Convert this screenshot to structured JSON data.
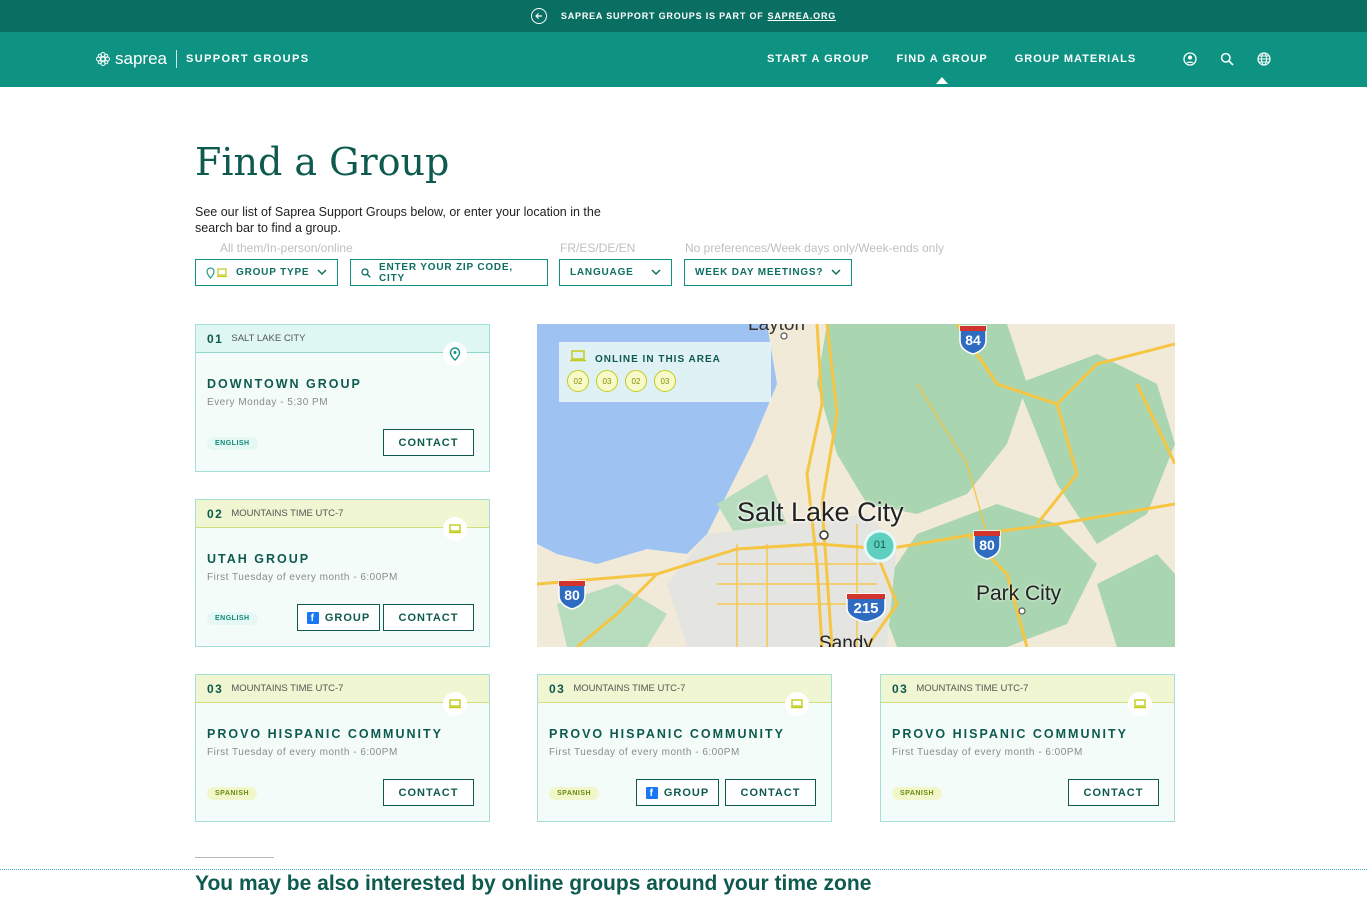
{
  "topbar": {
    "text": "SAPREA SUPPORT GROUPS IS PART OF",
    "link": "SAPREA.ORG"
  },
  "header": {
    "brand": "saprea",
    "sub": "SUPPORT GROUPS",
    "nav": [
      "START A GROUP",
      "FIND A GROUP",
      "GROUP MATERIALS"
    ],
    "active_nav": "FIND A GROUP",
    "icons": [
      "user-icon",
      "search-icon",
      "globe-icon"
    ]
  },
  "page": {
    "title": "Find a Group",
    "intro": "See our list of Saprea Support Groups below, or enter your location in the search bar to find a group."
  },
  "filters": {
    "hints": [
      "All them/In-person/online",
      "FR/ES/DE/EN",
      "No preferences/Week days only/Week-ends only"
    ],
    "group_type": "GROUP TYPE",
    "zip_placeholder": "ENTER YOUR ZIP CODE, CITY",
    "language": "LANGUAGE",
    "week_day": "WEEK DAY MEETINGS?"
  },
  "cards": [
    {
      "num": "01",
      "loc": "SALT LAKE CITY",
      "name": "DOWNTOWN GROUP",
      "when": "Every Monday - 5:30 PM",
      "lang": "ENGLISH",
      "type": "in-person",
      "group_btn": "",
      "contact": "CONTACT"
    },
    {
      "num": "02",
      "loc": "MOUNTAINS TIME UTC-7",
      "name": "UTAH GROUP",
      "when": "First Tuesday of every month - 6:00PM",
      "lang": "ENGLISH",
      "type": "online",
      "group_btn": "GROUP",
      "contact": "CONTACT"
    },
    {
      "num": "03",
      "loc": "MOUNTAINS TIME UTC-7",
      "name": "PROVO HISPANIC COMMUNITY",
      "when": "First Tuesday of every month - 6:00PM",
      "lang": "SPANISH",
      "type": "online",
      "group_btn": "",
      "contact": "CONTACT"
    },
    {
      "num": "03",
      "loc": "MOUNTAINS TIME UTC-7",
      "name": "PROVO HISPANIC COMMUNITY",
      "when": "First Tuesday of every month - 6:00PM",
      "lang": "SPANISH",
      "type": "online",
      "group_btn": "GROUP",
      "contact": "CONTACT"
    },
    {
      "num": "03",
      "loc": "MOUNTAINS TIME UTC-7",
      "name": "PROVO HISPANIC COMMUNITY",
      "when": "First Tuesday of every month - 6:00PM",
      "lang": "SPANISH",
      "type": "online",
      "group_btn": "",
      "contact": "CONTACT"
    }
  ],
  "map": {
    "online_label": "ONLINE IN THIS AREA",
    "online_pins": [
      "02",
      "03",
      "02",
      "03"
    ],
    "places": [
      "Layton",
      "Salt Lake City",
      "Park City",
      "Sandy"
    ],
    "highways": [
      "84",
      "80",
      "80",
      "215"
    ],
    "marker": "01"
  },
  "bottom": {
    "subhead": "You may be also interested by online groups around your time zone"
  }
}
